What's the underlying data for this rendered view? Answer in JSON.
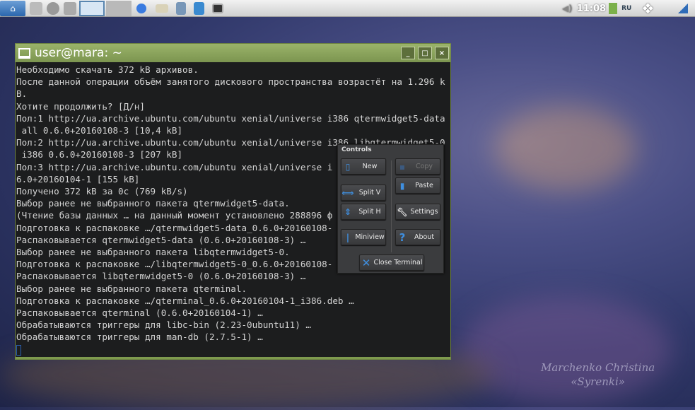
{
  "taskbar": {
    "clock": "11:08",
    "keyboard_layout": "RU",
    "icons": [
      "menu-icon",
      "file-manager-icon",
      "network-icon",
      "windows-icon",
      "desktop-1",
      "desktop-2",
      "chromium-icon",
      "folder-icon",
      "document-icon",
      "calendar-icon",
      "terminal-icon"
    ],
    "tray_icons": [
      "volume-icon",
      "battery-icon",
      "dropbox-icon",
      "signal-icon"
    ]
  },
  "window": {
    "title": "user@mara: ~",
    "buttons": {
      "minimize": "_",
      "maximize": "□",
      "close": "×"
    }
  },
  "terminal": {
    "lines": [
      "Необходимо скачать 372 kB архивов.",
      "После данной операции объём занятого дискового пространства возрастёт на 1.296 k",
      "B.",
      "Хотите продолжить? [Д/н]",
      "Пол:1 http://ua.archive.ubuntu.com/ubuntu xenial/universe i386 qtermwidget5-data",
      " all 0.6.0+20160108-3 [10,4 kB]",
      "Пол:2 http://ua.archive.ubuntu.com/ubuntu xenial/universe i386 libqtermwidget5-0",
      " i386 0.6.0+20160108-3 [207 kB]",
      "Пол:3 http://ua.archive.ubuntu.com/ubuntu xenial/universe i",
      "6.0+20160104-1 [155 kB]",
      "Получено 372 kB за 0c (769 kB/s)",
      "Выбор ранее не выбранного пакета qtermwidget5-data.",
      "(Чтение базы данных … на данный момент установлено 288896 ф",
      "Подготовка к распаковке …/qtermwidget5-data_0.6.0+20160108-",
      "Распаковывается qtermwidget5-data (0.6.0+20160108-3) …",
      "Выбор ранее не выбранного пакета libqtermwidget5-0.",
      "Подготовка к распаковке …/libqtermwidget5-0_0.6.0+20160108-",
      "Распаковывается libqtermwidget5-0 (0.6.0+20160108-3) …",
      "Выбор ранее не выбранного пакета qterminal.",
      "Подготовка к распаковке …/qterminal_0.6.0+20160104-1_i386.deb …",
      "Распаковывается qterminal (0.6.0+20160104-1) …",
      "Обрабатываются триггеры для libc-bin (2.23-0ubuntu11) …",
      "Обрабатываются триггеры для man-db (2.7.5-1) …"
    ]
  },
  "controls": {
    "title": "Controls",
    "new": "New",
    "copy": "Copy",
    "paste": "Paste",
    "split_v": "Split V",
    "split_h": "Split H",
    "settings": "Settings",
    "miniview": "Miniview",
    "about": "About",
    "close_terminal": "Close Terminal"
  },
  "wallpaper": {
    "signature_line1": "Marchenko Christina",
    "signature_line2": "«Syrenki»"
  }
}
